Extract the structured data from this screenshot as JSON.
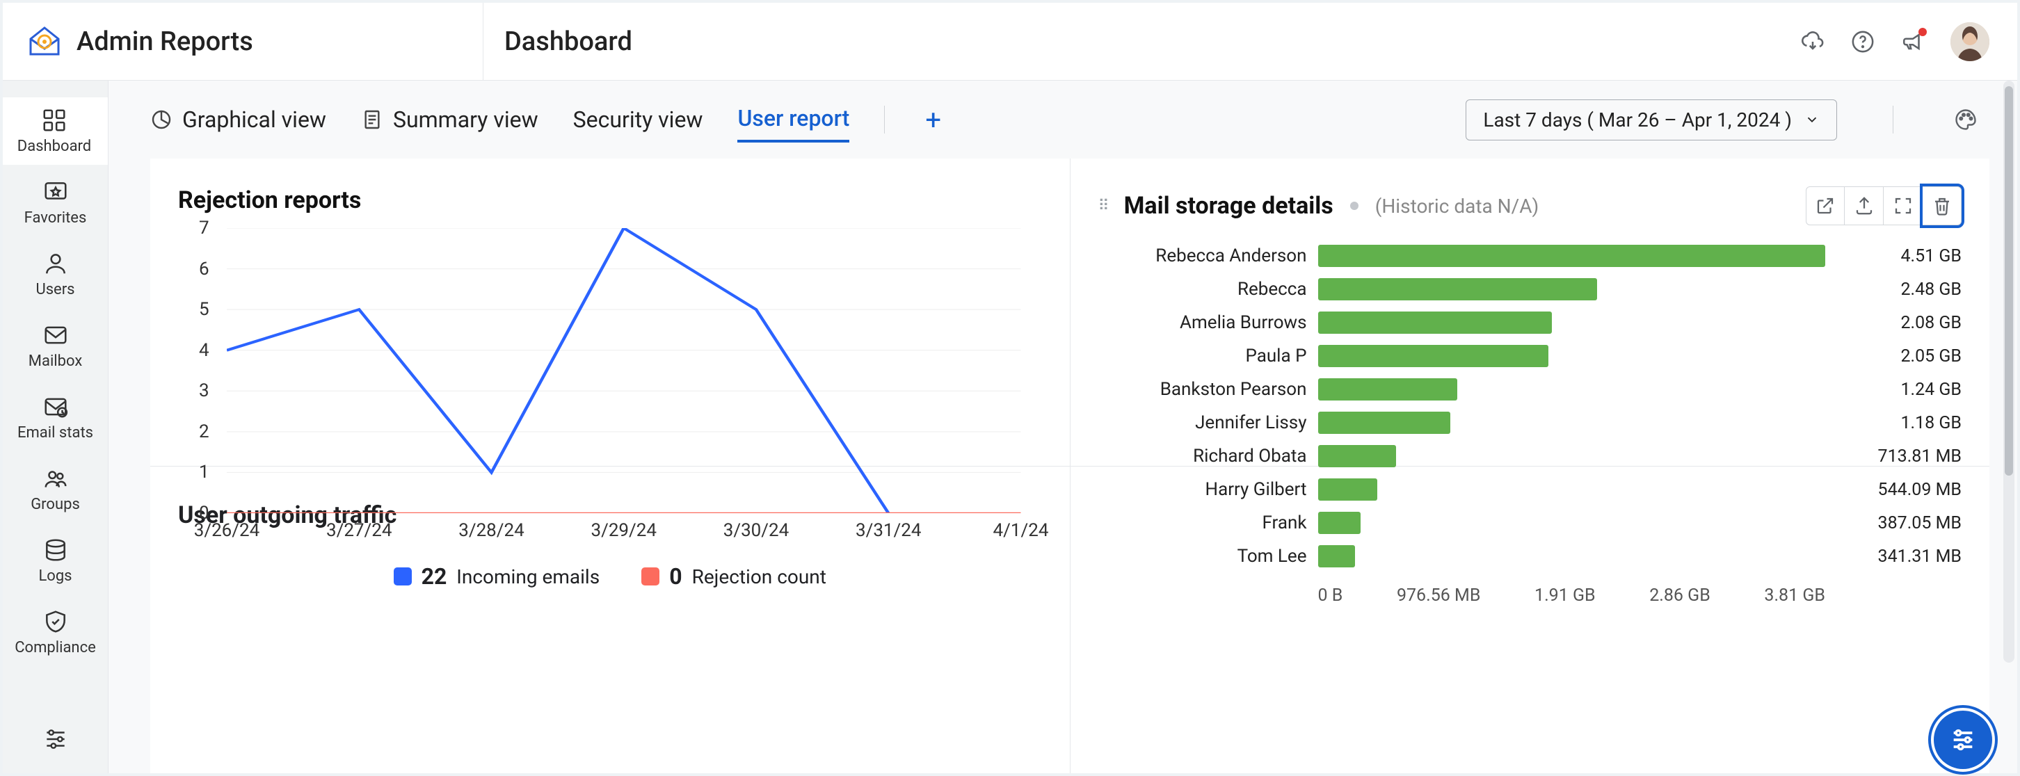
{
  "brand": {
    "title": "Admin Reports"
  },
  "header": {
    "page_title": "Dashboard"
  },
  "sidebar": {
    "items": [
      {
        "label": "Dashboard"
      },
      {
        "label": "Favorites"
      },
      {
        "label": "Users"
      },
      {
        "label": "Mailbox"
      },
      {
        "label": "Email stats"
      },
      {
        "label": "Groups"
      },
      {
        "label": "Logs"
      },
      {
        "label": "Compliance"
      }
    ]
  },
  "toolbar": {
    "tabs": {
      "graphical": "Graphical view",
      "summary": "Summary view",
      "security": "Security view",
      "user_report": "User report"
    },
    "date_range": "Last 7 days ( Mar 26 – Apr 1, 2024 )"
  },
  "panels": {
    "rejection": {
      "title": "Rejection reports"
    },
    "storage": {
      "title": "Mail storage details",
      "subtitle": "(Historic data N/A)"
    },
    "outgoing": {
      "title": "User outgoing traffic"
    }
  },
  "legend": {
    "incoming_count": "22",
    "incoming_label": "Incoming emails",
    "rejection_count": "0",
    "rejection_label": "Rejection count"
  },
  "chart_data": [
    {
      "id": "rejection_line",
      "type": "line",
      "title": "Rejection reports",
      "x": [
        "3/26/24",
        "3/27/24",
        "3/28/24",
        "3/29/24",
        "3/30/24",
        "3/31/24",
        "4/1/24"
      ],
      "series": [
        {
          "name": "Incoming emails",
          "color": "#2b63ff",
          "values": [
            4,
            5,
            1,
            7,
            5,
            0,
            0
          ],
          "total": 22
        },
        {
          "name": "Rejection count",
          "color": "#fc6b5d",
          "values": [
            0,
            0,
            0,
            0,
            0,
            0,
            0
          ],
          "total": 0
        }
      ],
      "ylabel": "",
      "xlabel": "",
      "ylim": [
        0,
        7
      ]
    },
    {
      "id": "storage_bar",
      "type": "bar",
      "orientation": "horizontal",
      "title": "Mail storage details",
      "categories": [
        "Rebecca Anderson",
        "Rebecca",
        "Amelia Burrows",
        "Paula P",
        "Bankston Pearson",
        "Jennifer Lissy",
        "Richard Obata",
        "Harry Gilbert",
        "Frank",
        "Tom Lee"
      ],
      "values_gb": [
        4.51,
        2.48,
        2.08,
        2.05,
        1.24,
        1.18,
        0.697,
        0.531,
        0.378,
        0.333
      ],
      "value_labels": [
        "4.51 GB",
        "2.48 GB",
        "2.08 GB",
        "2.05 GB",
        "1.24 GB",
        "1.18 GB",
        "713.81 MB",
        "544.09 MB",
        "387.05 MB",
        "341.31 MB"
      ],
      "x_ticks": [
        "0 B",
        "976.56 MB",
        "1.91 GB",
        "2.86 GB",
        "3.81 GB"
      ],
      "xlim_gb": [
        0,
        4.51
      ],
      "bar_color": "#61b14c"
    }
  ]
}
